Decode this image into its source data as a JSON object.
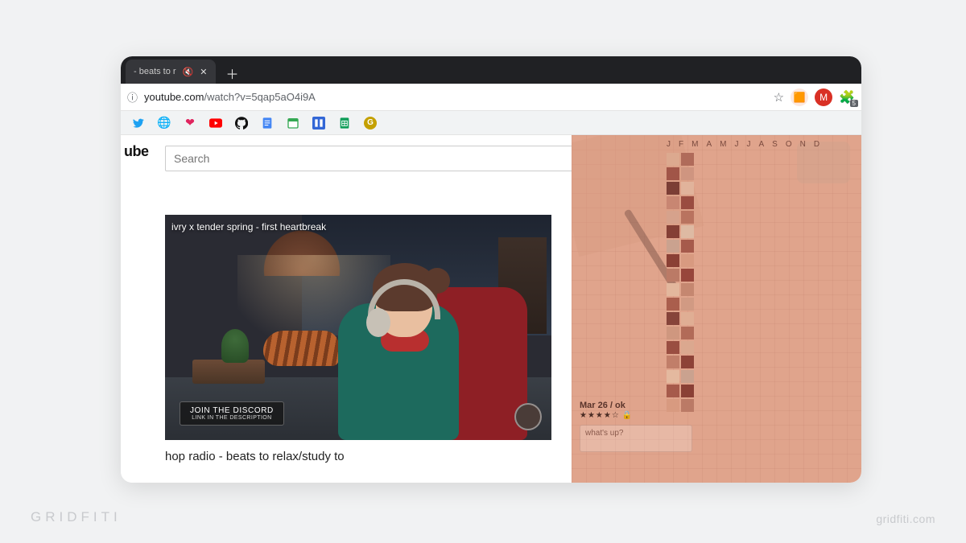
{
  "browser": {
    "tab_title": "- beats to r",
    "url_prefix": "youtube.com",
    "url_path": "/watch?v=5qap5aO4i9A",
    "extensions_count": "5"
  },
  "bookmarks": [
    {
      "name": "twitter",
      "color": "#1DA1F2",
      "glyph": "t"
    },
    {
      "name": "globe",
      "color": "#6b6b6b",
      "glyph": "g"
    },
    {
      "name": "heart",
      "color": "#e0245e",
      "glyph": "h"
    },
    {
      "name": "youtube",
      "color": "#ff0000",
      "glyph": "y"
    },
    {
      "name": "github",
      "color": "#111111",
      "glyph": "gh"
    },
    {
      "name": "google-docs",
      "color": "#4285f4",
      "glyph": "d"
    },
    {
      "name": "google-calendar",
      "color": "#34a853",
      "glyph": "c"
    },
    {
      "name": "app-blue",
      "color": "#3367d6",
      "glyph": "a"
    },
    {
      "name": "google-sheets",
      "color": "#0f9d58",
      "glyph": "s"
    },
    {
      "name": "grammarly",
      "color": "#c4a000",
      "glyph": "G"
    }
  ],
  "youtube": {
    "logo_fragment": "ube",
    "search_placeholder": "Search",
    "overlay_title": "ivry x tender spring - first heartbreak",
    "discord_label": "JOIN THE DISCORD",
    "discord_sub": "LINK IN THE DESCRIPTION",
    "video_title_below": "hop radio - beats to relax/study to"
  },
  "ext": {
    "months": [
      "J",
      "F",
      "M",
      "A",
      "M",
      "J",
      "J",
      "A",
      "S",
      "O",
      "N",
      "D"
    ],
    "entry_date": "Mar 26 / ok",
    "entry_stars": "★★★★☆",
    "note_placeholder": "what's up?",
    "pixels": [
      "#dca98f",
      "#b06b5a",
      "#a15548",
      "#cf9580",
      "#7b3e35",
      "#e1b39b",
      "#c88672",
      "#9a4c40",
      "#d6a28c",
      "#b9735f",
      "#843f35",
      "#debaa3",
      "#caa28f",
      "#a65a4b",
      "#8a4035",
      "#d89a80",
      "#bb7a66",
      "#97463b",
      "#e3b79d",
      "#c58770",
      "#aa5e4d",
      "#d19a83",
      "#86443a",
      "#e0ae94",
      "#cf977f",
      "#b26b58",
      "#9a4e41",
      "#dba88f",
      "#c17e69",
      "#8d4237",
      "#e4b99f",
      "#caa28f",
      "#a65a4b",
      "#8a4035",
      "#d89a80",
      "#bb7a66"
    ]
  },
  "watermark": {
    "left": "GRIDFITI",
    "right": "gridfiti.com"
  }
}
